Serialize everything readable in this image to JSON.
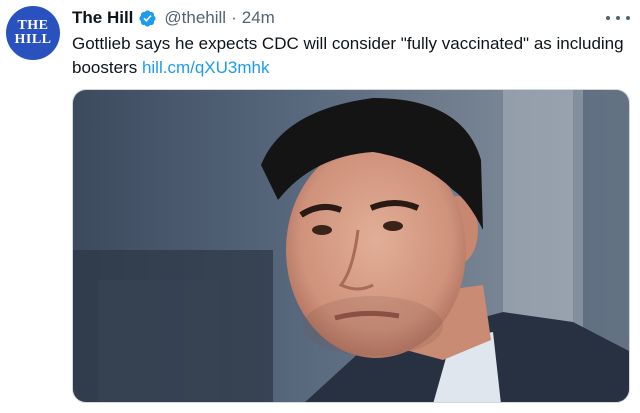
{
  "author": {
    "avatar_line1": "THE",
    "avatar_line2": "HILL",
    "display_name": "The Hill",
    "handle": "@thehill",
    "separator": "·",
    "time": "24m",
    "verified": true
  },
  "tweet": {
    "text": "Gottlieb says he expects CDC will consider \"fully vaccinated\" as including boosters",
    "link": "hill.cm/qXU3mhk"
  },
  "icons": {
    "verified": "verified-badge-icon",
    "more": "more-options-icon"
  },
  "colors": {
    "link": "#1d9bf0",
    "avatar_bg": "#2a52be",
    "secondary_text": "#536471"
  }
}
